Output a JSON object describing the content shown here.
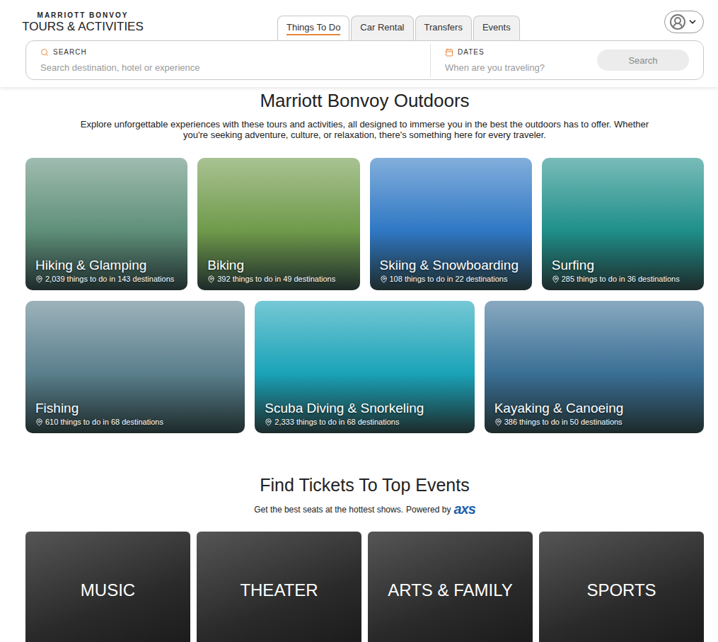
{
  "logo": {
    "brand": "MARRIOTT BONVOY",
    "product": "TOURS & ACTIVITIES"
  },
  "tabs": [
    {
      "label": "Things To Do",
      "selected": true
    },
    {
      "label": "Car Rental",
      "selected": false
    },
    {
      "label": "Transfers",
      "selected": false
    },
    {
      "label": "Events",
      "selected": false
    }
  ],
  "search": {
    "label": "SEARCH",
    "placeholder": "Search destination, hotel or experience"
  },
  "dates": {
    "label": "DATES",
    "placeholder": "When are you traveling?"
  },
  "search_button": "Search",
  "outdoors": {
    "title": "Marriott Bonvoy Outdoors",
    "description": "Explore unforgettable experiences with these tours and activities, all designed to immerse you in the best the outdoors has to offer. Whether you're seeking adventure, culture, or relaxation, there's something here for every traveler.",
    "categories": [
      {
        "title": "Hiking & Glamping",
        "count": "2,039 things to do in 143 destinations",
        "color": "#5f8f7a"
      },
      {
        "title": "Biking",
        "count": "392 things to do in 49 destinations",
        "color": "#6f9a4a"
      },
      {
        "title": "Skiing & Snowboarding",
        "count": "108 things to do in 22 destinations",
        "color": "#2f78c4"
      },
      {
        "title": "Surfing",
        "count": "285 things to do in 36 destinations",
        "color": "#1f8f8a"
      },
      {
        "title": "Fishing",
        "count": "610 things to do in 68 destinations",
        "color": "#5a7f8c"
      },
      {
        "title": "Scuba Diving & Snorkeling",
        "count": "2,333 things to do in 68 destinations",
        "color": "#1aa3b8"
      },
      {
        "title": "Kayaking & Canoeing",
        "count": "386 things to do in 50 destinations",
        "color": "#3a6f95"
      }
    ]
  },
  "events": {
    "title": "Find Tickets To Top Events",
    "subtitle": "Get the best seats at the hottest shows.",
    "powered_by": "Powered by",
    "partner": "axs",
    "categories": [
      {
        "label": "MUSIC"
      },
      {
        "label": "THEATER"
      },
      {
        "label": "ARTS & FAMILY"
      },
      {
        "label": "SPORTS"
      }
    ]
  }
}
